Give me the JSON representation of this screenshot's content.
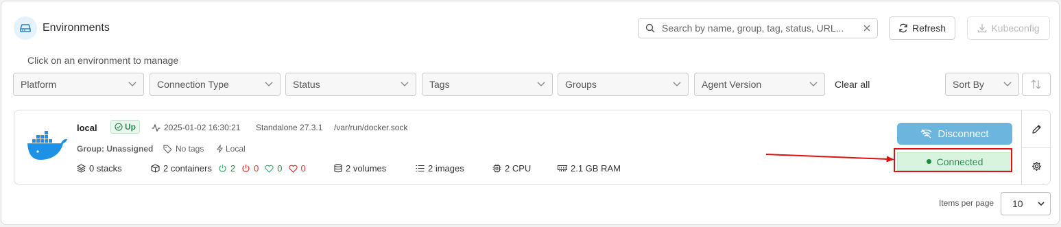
{
  "header": {
    "title": "Environments",
    "subtitle": "Click on an environment to manage",
    "search_placeholder": "Search by name, group, tag, status, URL...",
    "refresh_label": "Refresh",
    "kubeconfig_label": "Kubeconfig"
  },
  "filters": {
    "items": [
      {
        "label": "Platform"
      },
      {
        "label": "Connection Type"
      },
      {
        "label": "Status"
      },
      {
        "label": "Tags"
      },
      {
        "label": "Groups"
      },
      {
        "label": "Agent Version"
      }
    ],
    "clear_all": "Clear all",
    "sort_by": "Sort By"
  },
  "environment": {
    "name": "local",
    "status": "Up",
    "timestamp": "2025-01-02 16:30:21",
    "type": "Standalone 27.3.1",
    "url": "/var/run/docker.sock",
    "group": "Group: Unassigned",
    "tags": "No tags",
    "connection": "Local",
    "stacks": "0 stacks",
    "containers": "2 containers",
    "healthy": "2",
    "stopped": "0",
    "healthy_heart": "0",
    "unhealthy_heart": "0",
    "volumes": "2 volumes",
    "images": "2 images",
    "cpu": "2 CPU",
    "ram": "2.1 GB RAM",
    "disconnect_label": "Disconnect",
    "connected_label": "Connected"
  },
  "pagination": {
    "items_per_page_label": "Items per page",
    "items_per_page_value": "10"
  },
  "colors": {
    "accent": "#6bb5de",
    "success": "#2e8b57",
    "danger": "#e01010"
  }
}
